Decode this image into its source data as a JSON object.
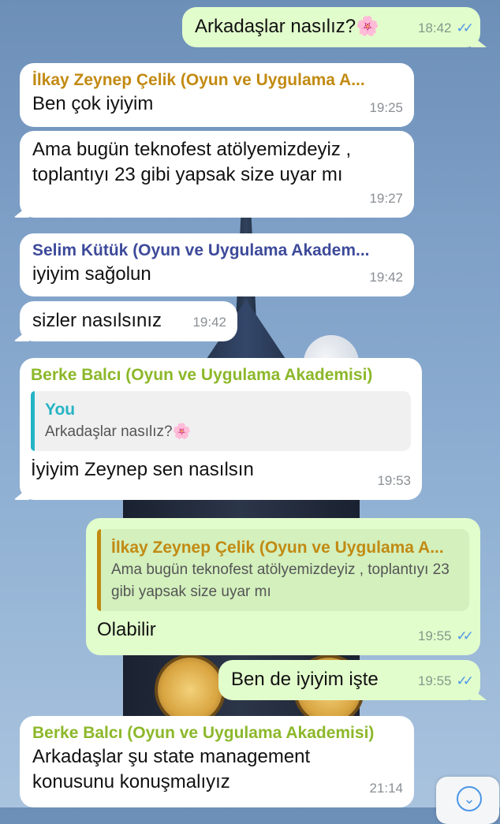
{
  "colors": {
    "incoming_bubble": "#ffffff",
    "outgoing_bubble": "#e2fdcc",
    "name_ilkay": "#c28a12",
    "name_selim": "#3d4a9a",
    "name_berke": "#8cb82a",
    "reply_you": "#26b3c4",
    "read_ticks": "#4b96e6"
  },
  "messages": [
    {
      "text": "Arkadaşlar nasılız?🌸",
      "time": "18:42",
      "ticks": "✓✓"
    },
    {
      "sender": "İlkay Zeynep Çelik (Oyun ve Uygulama A...",
      "text": "Ben çok iyiyim",
      "time": "19:25"
    },
    {
      "text": "Ama bugün teknofest atölyemizdeyiz ,\ntoplantıyı 23 gibi yapsak size uyar mı",
      "time": "19:27"
    },
    {
      "sender": "Selim Kütük (Oyun ve Uygulama Akadem...",
      "text": "iyiyim sağolun",
      "time": "19:42"
    },
    {
      "text": "sizler nasılsınız",
      "time": "19:42"
    },
    {
      "sender": "Berke Balcı (Oyun ve Uygulama Akademisi)",
      "reply_name": "You",
      "reply_text": "Arkadaşlar nasılız?🌸",
      "text": "İyiyim Zeynep sen nasılsın",
      "time": "19:53"
    },
    {
      "reply_name": "İlkay Zeynep Çelik (Oyun ve Uygulama A...",
      "reply_text": "Ama bugün teknofest atölyemizdeyiz , toplantıyı 23 gibi yapsak size uyar mı",
      "text": "Olabilir",
      "time": "19:55",
      "ticks": "✓✓"
    },
    {
      "text": "Ben de iyiyim işte",
      "time": "19:55",
      "ticks": "✓✓"
    },
    {
      "sender": "Berke Balcı (Oyun ve Uygulama Akademisi)",
      "text": "Arkadaşlar şu state management\nkonusunu konuşmalıyız",
      "time": "21:14"
    }
  ],
  "scroll_icon": "chevron-down-icon"
}
